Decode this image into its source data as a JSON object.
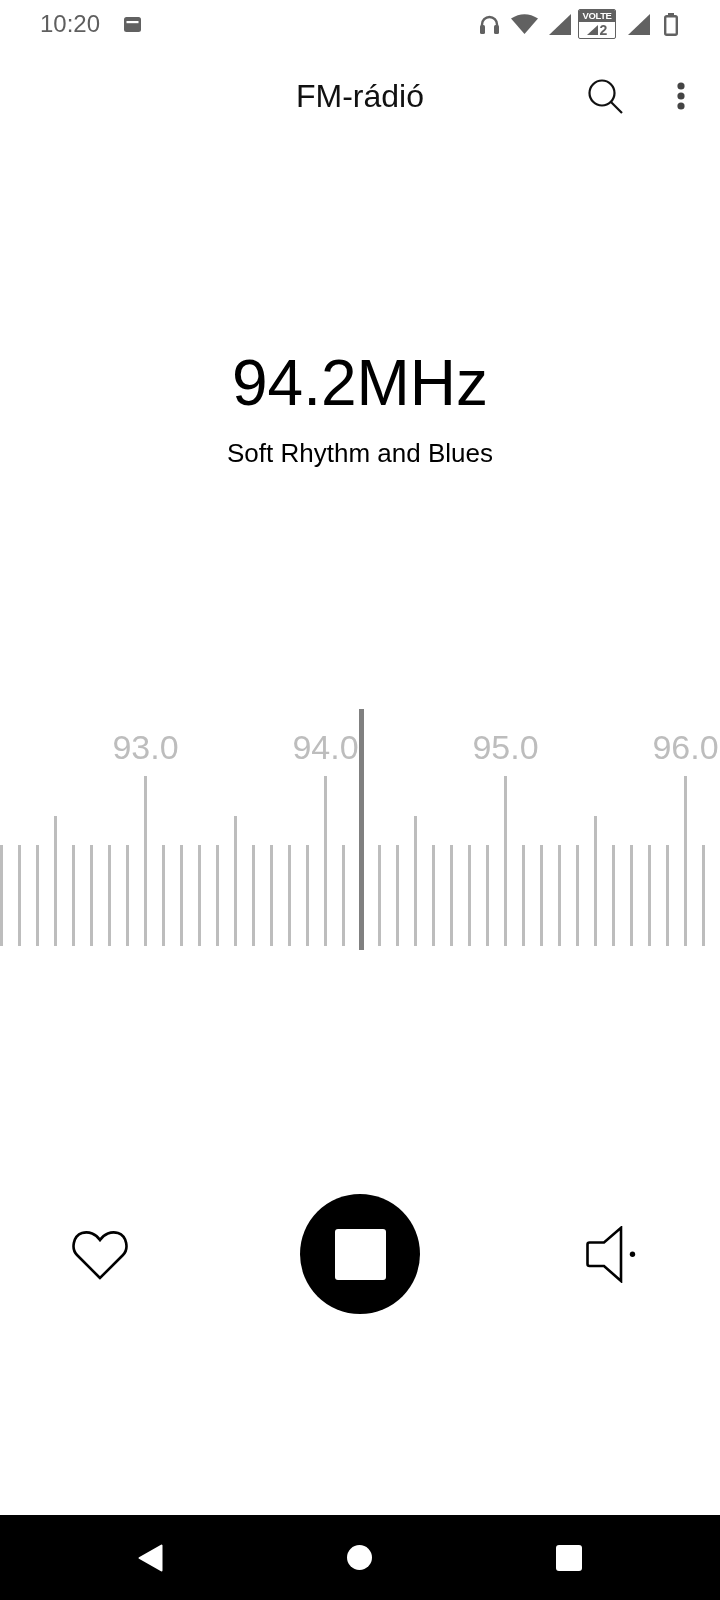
{
  "status_bar": {
    "time": "10:20",
    "volte_label": "VOLTE",
    "sim_slot": "2"
  },
  "app_bar": {
    "title": "FM-rádió"
  },
  "station": {
    "frequency": "94.2MHz",
    "name": "Soft Rhythm and Blues"
  },
  "tuner": {
    "scale_labels": [
      "93.0",
      "94.0",
      "95.0",
      "96.0"
    ],
    "level": 0.502
  },
  "controls": {
    "favorite": false,
    "playing": true
  }
}
